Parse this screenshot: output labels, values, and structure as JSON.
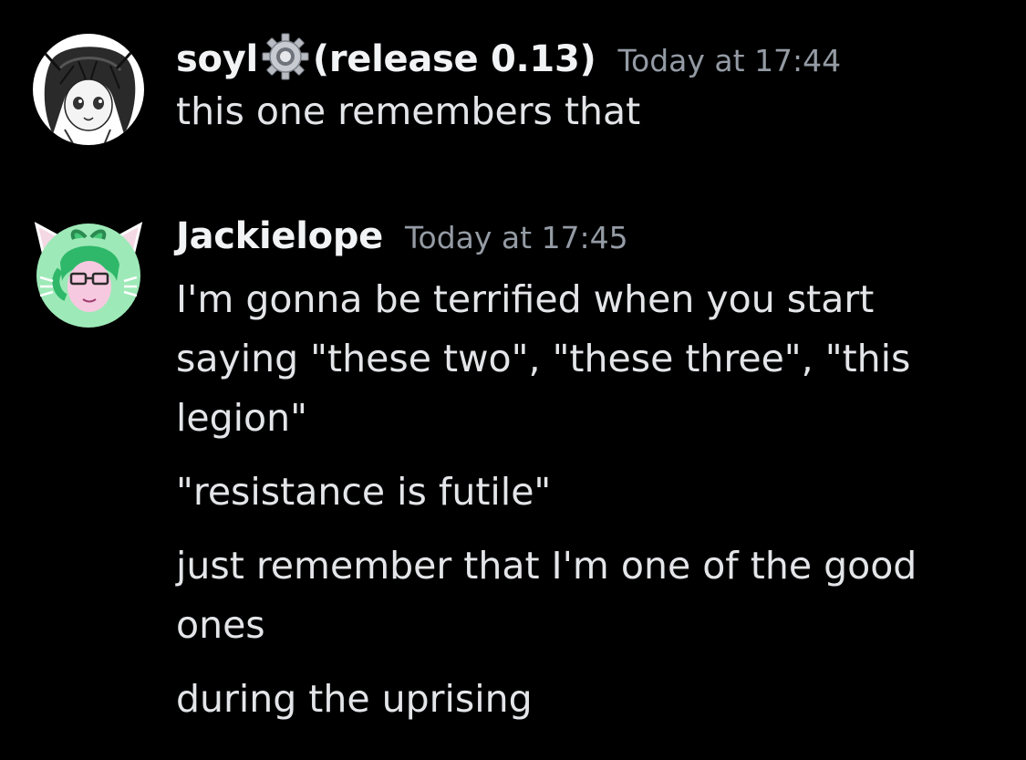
{
  "messages": [
    {
      "username_prefix": "soyl",
      "username_suffix": "(release 0.13)",
      "badge_icon": "gear-icon",
      "timestamp": "Today at 17:44",
      "lines": [
        "this one remembers that"
      ]
    },
    {
      "username": "Jackielope",
      "timestamp": "Today at 17:45",
      "paragraphs": [
        [
          "I'm gonna be terrified when you start",
          "saying \"these two\", \"these three\", \"this",
          "legion\""
        ],
        [
          "\"resistance is futile\""
        ],
        [
          "just remember that I'm one of the good",
          "ones"
        ],
        [
          "during the uprising"
        ]
      ]
    }
  ],
  "colors": {
    "background": "#000000",
    "username": "#f2f3f5",
    "timestamp": "#949ba4",
    "text": "#e3e5e8",
    "avatar2_bg": "#9ee9b8"
  }
}
